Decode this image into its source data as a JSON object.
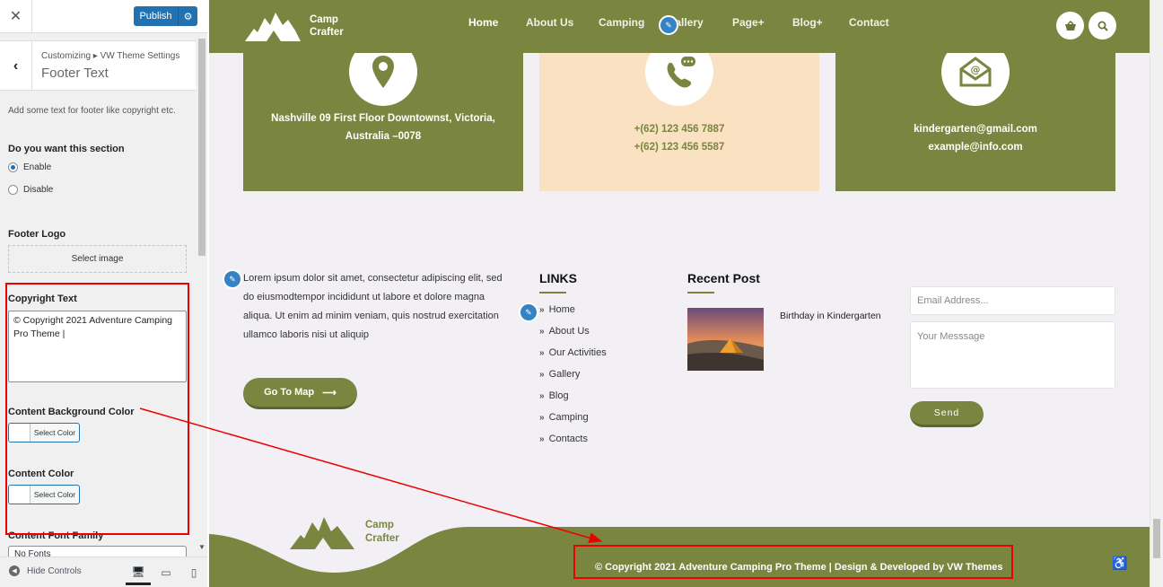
{
  "customizer": {
    "close_icon": "close-icon",
    "publish_label": "Publish",
    "breadcrumb": "Customizing ▸ VW Theme Settings",
    "section_title": "Footer Text",
    "description": "Add some text for footer like copyright etc.",
    "section_toggle": {
      "label": "Do you want this section",
      "options": [
        "Enable",
        "Disable"
      ],
      "selected": "Enable"
    },
    "footer_logo": {
      "label": "Footer Logo",
      "button": "Select image"
    },
    "copyright": {
      "label": "Copyright Text",
      "value": "© Copyright 2021 Adventure Camping Pro Theme |"
    },
    "content_bg_color": {
      "label": "Content Background Color",
      "button": "Select Color"
    },
    "content_color": {
      "label": "Content Color",
      "button": "Select Color"
    },
    "content_font": {
      "label": "Content Font Family",
      "value": "No Fonts"
    },
    "hide_controls": "Hide Controls"
  },
  "site": {
    "logo": {
      "line1": "Camp",
      "line2": "Crafter"
    },
    "nav": [
      "Home",
      "About Us",
      "Camping",
      "Gallery",
      "Page+",
      "Blog+",
      "Contact"
    ],
    "active_nav": "Home",
    "contact_cards": [
      {
        "icon": "location-pin-icon",
        "lines": [
          "Nashville 09 First Floor Downtownst, Victoria,",
          "Australia –0078"
        ],
        "bg": "#7a8540",
        "text_color": "#ffffff"
      },
      {
        "icon": "phone-chat-icon",
        "lines": [
          "+(62) 123 456 7887",
          "+(62) 123 456 5587"
        ],
        "bg": "#f9e1c1",
        "text_color": "#7a8540"
      },
      {
        "icon": "email-icon",
        "lines": [
          "kindergarten@gmail.com",
          "example@info.com"
        ],
        "bg": "#7a8540",
        "text_color": "#ffffff"
      }
    ],
    "about_text": "Lorem ipsum dolor sit amet, consectetur adipiscing elit, sed do eiusmodtempor incididunt ut labore et dolore magna aliqua. Ut enim ad minim veniam, quis nostrud exercitation ullamco laboris nisi ut aliquip",
    "go_to_map": "Go To Map",
    "links_title": "LINKS",
    "links": [
      "Home",
      "About Us",
      "Our Activities",
      "Gallery",
      "Blog",
      "Camping",
      "Contacts"
    ],
    "recent_post_title": "Recent Post",
    "recent_post": {
      "title": "Birthday in Kindergarten"
    },
    "email_placeholder": "Email Address...",
    "message_placeholder": "Your Messsage",
    "send_label": "Send",
    "footer_copyright": "© Copyright 2021 Adventure Camping Pro Theme | Design & Developed by VW Themes"
  },
  "colors": {
    "brand_olive": "#7a8540",
    "peach": "#f9e1c1",
    "wp_blue": "#2271b1",
    "annotation_red": "#ee0000"
  }
}
